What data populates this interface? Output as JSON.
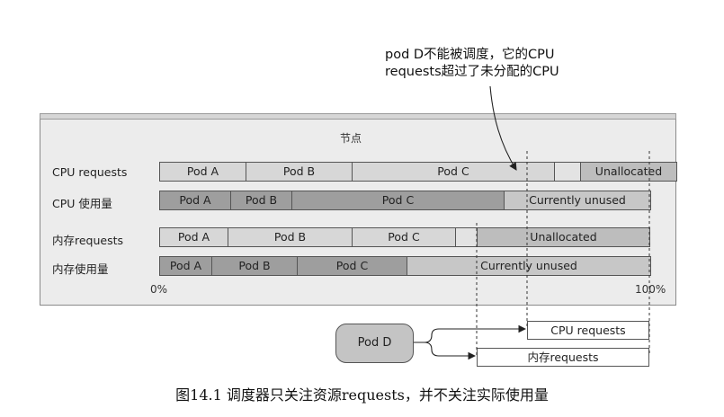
{
  "callout": {
    "line1": "pod D不能被调度，它的CPU",
    "line2": "requests超过了未分配的CPU"
  },
  "node": {
    "title": "节点"
  },
  "rows": [
    {
      "label": "CPU requests",
      "segments": [
        "Pod A",
        "Pod B",
        "Pod C",
        "",
        "Unallocated"
      ]
    },
    {
      "label": "CPU 使用量",
      "segments": [
        "Pod A",
        "Pod B",
        "Pod C",
        "Currently unused"
      ]
    },
    {
      "label": "内存requests",
      "segments": [
        "Pod A",
        "Pod B",
        "Pod C",
        "",
        "Unallocated"
      ]
    },
    {
      "label": "内存使用量",
      "segments": [
        "Pod A",
        "Pod B",
        "Pod C",
        "Currently unused"
      ]
    }
  ],
  "axis": {
    "start": "0%",
    "end": "100%"
  },
  "pod_d": {
    "label": "Pod D"
  },
  "pod_d_requests": {
    "cpu": "CPU requests",
    "memory": "内存requests"
  },
  "caption": "图14.1 调度器只关注资源requests，并不关注实际使用量"
}
